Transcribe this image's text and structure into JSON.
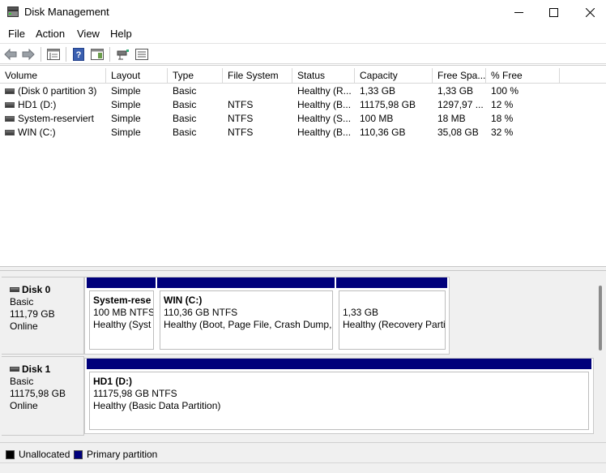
{
  "window": {
    "title": "Disk Management"
  },
  "menu": {
    "items": [
      "File",
      "Action",
      "View",
      "Help"
    ]
  },
  "toolbar": {
    "buttons": [
      "back-arrow-icon",
      "forward-arrow-icon",
      "properties-icon",
      "help-icon",
      "show-hide-icon",
      "connect-icon",
      "list-view-icon"
    ]
  },
  "volumes": {
    "columns": [
      "Volume",
      "Layout",
      "Type",
      "File System",
      "Status",
      "Capacity",
      "Free Spa...",
      "% Free"
    ],
    "rows": [
      {
        "volume": "(Disk 0 partition 3)",
        "layout": "Simple",
        "type": "Basic",
        "fs": "",
        "status": "Healthy (R...",
        "capacity": "1,33 GB",
        "free": "1,33 GB",
        "pct": "100 %"
      },
      {
        "volume": "HD1 (D:)",
        "layout": "Simple",
        "type": "Basic",
        "fs": "NTFS",
        "status": "Healthy (B...",
        "capacity": "11175,98 GB",
        "free": "1297,97 ...",
        "pct": "12 %"
      },
      {
        "volume": "System-reserviert",
        "layout": "Simple",
        "type": "Basic",
        "fs": "NTFS",
        "status": "Healthy (S...",
        "capacity": "100 MB",
        "free": "18 MB",
        "pct": "18 %"
      },
      {
        "volume": "WIN (C:)",
        "layout": "Simple",
        "type": "Basic",
        "fs": "NTFS",
        "status": "Healthy (B...",
        "capacity": "110,36 GB",
        "free": "35,08 GB",
        "pct": "32 %"
      }
    ]
  },
  "disks": [
    {
      "name": "Disk 0",
      "type": "Basic",
      "size": "111,79 GB",
      "state": "Online",
      "partitions": [
        {
          "title": "System-rese",
          "size": "100 MB NTFS",
          "status": "Healthy (Syst"
        },
        {
          "title": "WIN  (C:)",
          "size": "110,36 GB NTFS",
          "status": "Healthy (Boot, Page File, Crash Dump,"
        },
        {
          "title": "",
          "size": "1,33 GB",
          "status": "Healthy (Recovery Parti"
        }
      ]
    },
    {
      "name": "Disk 1",
      "type": "Basic",
      "size": "11175,98 GB",
      "state": "Online",
      "partitions": [
        {
          "title": "HD1  (D:)",
          "size": "11175,98 GB NTFS",
          "status": "Healthy (Basic Data Partition)"
        }
      ]
    }
  ],
  "legend": {
    "unallocated": "Unallocated",
    "primary": "Primary partition",
    "unallocated_color": "#000000",
    "primary_color": "#00007b"
  }
}
